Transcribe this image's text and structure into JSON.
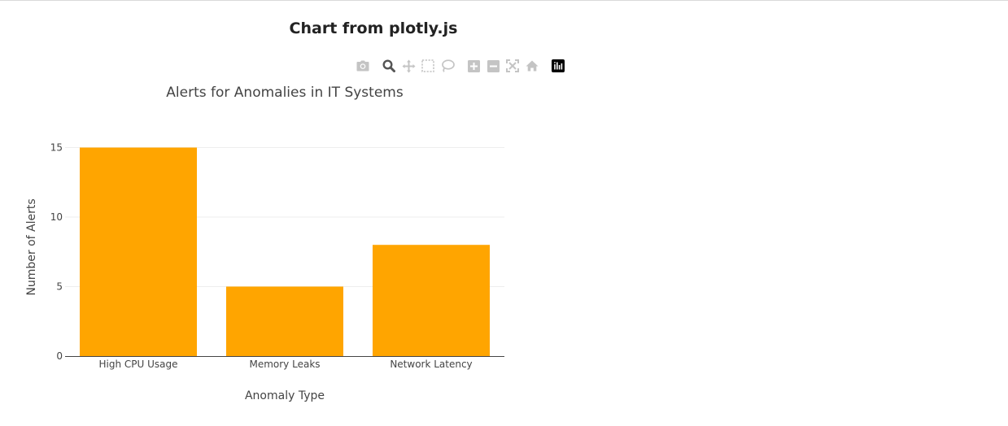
{
  "page": {
    "title": "Chart from plotly.js"
  },
  "modebar": {
    "buttons": [
      {
        "name": "camera-icon",
        "label": "Download plot as a png"
      },
      {
        "name": "zoom-icon",
        "label": "Zoom",
        "active": true
      },
      {
        "name": "pan-icon",
        "label": "Pan"
      },
      {
        "name": "box-select-icon",
        "label": "Box Select"
      },
      {
        "name": "lasso-select-icon",
        "label": "Lasso Select"
      },
      {
        "name": "zoom-in-icon",
        "label": "Zoom in"
      },
      {
        "name": "zoom-out-icon",
        "label": "Zoom out"
      },
      {
        "name": "autoscale-icon",
        "label": "Autoscale"
      },
      {
        "name": "reset-axes-icon",
        "label": "Reset axes"
      },
      {
        "name": "plotly-logo-icon",
        "label": "Produced with Plotly"
      }
    ]
  },
  "chart_data": {
    "type": "bar",
    "title": "Alerts for Anomalies in IT Systems",
    "xlabel": "Anomaly Type",
    "ylabel": "Number of Alerts",
    "categories": [
      "High CPU Usage",
      "Memory Leaks",
      "Network Latency"
    ],
    "values": [
      15,
      5,
      8
    ],
    "ylim": [
      0,
      15.79
    ],
    "yticks": [
      0,
      5,
      10,
      15
    ],
    "grid": true,
    "bar_color": "#FFA500",
    "grid_color": "#eeeeee",
    "axis_color": "#444444"
  }
}
